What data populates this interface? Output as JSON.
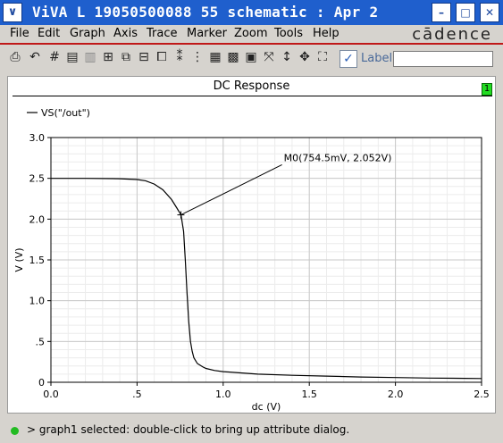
{
  "window": {
    "title": "ViVA L  19050500088 55 schematic : Apr 2",
    "menu_glyph": "∨",
    "btn_minimize": "–",
    "btn_maximize": "□",
    "btn_close": "✕"
  },
  "menubar": {
    "items": [
      "File",
      "Edit",
      "Graph",
      "Axis",
      "Trace",
      "Marker",
      "Zoom",
      "Tools",
      "Help"
    ],
    "brand": "cādence"
  },
  "toolbar": {
    "icons": [
      "print-icon",
      "undo-icon",
      "grid-icon",
      "strip-icon",
      "strip-disabled-icon",
      "subwindow-icon",
      "subwindow-add-icon",
      "subwindow-delete-icon",
      "subwindow-move-icon",
      "bus-icon",
      "select-all-icon",
      "deselect-icon",
      "calculator-icon",
      "zoom-x-icon",
      "zoom-y-icon",
      "fit-icon",
      "fit-all-icon"
    ],
    "label_checkbox_checked": true,
    "label_text": "Label",
    "label_input_value": ""
  },
  "graph": {
    "title": "DC Response",
    "subwindow_number": "1",
    "subwindow_color": "#22dd22"
  },
  "chart_data": {
    "type": "line",
    "xlabel": "dc (V)",
    "ylabel": "V (V)",
    "xlim": [
      0.0,
      2.5
    ],
    "ylim": [
      0.0,
      3.0
    ],
    "xticks": [
      0.0,
      0.5,
      1.0,
      1.5,
      2.0,
      2.5
    ],
    "xtick_labels": [
      "0.0",
      ".5",
      "1.0",
      "1.5",
      "2.0",
      "2.5"
    ],
    "yticks": [
      0.0,
      0.5,
      1.0,
      1.5,
      2.0,
      2.5,
      3.0
    ],
    "ytick_labels": [
      "0",
      ".5",
      "1.0",
      "1.5",
      "2.0",
      "2.5",
      "3.0"
    ],
    "grid": true,
    "legend_position": "top-left",
    "series": [
      {
        "name": "VS(\"/out\")",
        "color": "#000000",
        "x": [
          0.0,
          0.2,
          0.4,
          0.5,
          0.55,
          0.6,
          0.65,
          0.7,
          0.73,
          0.755,
          0.77,
          0.78,
          0.79,
          0.8,
          0.81,
          0.82,
          0.83,
          0.85,
          0.88,
          0.9,
          0.95,
          1.0,
          1.1,
          1.2,
          1.4,
          1.6,
          1.8,
          2.0,
          2.2,
          2.4,
          2.5
        ],
        "y": [
          2.5,
          2.5,
          2.495,
          2.485,
          2.47,
          2.43,
          2.36,
          2.24,
          2.14,
          2.052,
          1.85,
          1.5,
          1.1,
          0.75,
          0.5,
          0.38,
          0.3,
          0.23,
          0.19,
          0.17,
          0.145,
          0.13,
          0.115,
          0.1,
          0.085,
          0.075,
          0.065,
          0.058,
          0.052,
          0.048,
          0.046
        ]
      }
    ],
    "markers": [
      {
        "label": "M0(754.5mV, 2.052V)",
        "x": 0.7545,
        "y": 2.052,
        "label_x": 1.3,
        "label_y": 2.71
      }
    ]
  },
  "status": {
    "dot_color": "#22bb22",
    "text": "> graph1 selected: double-click to bring up attribute dialog."
  }
}
